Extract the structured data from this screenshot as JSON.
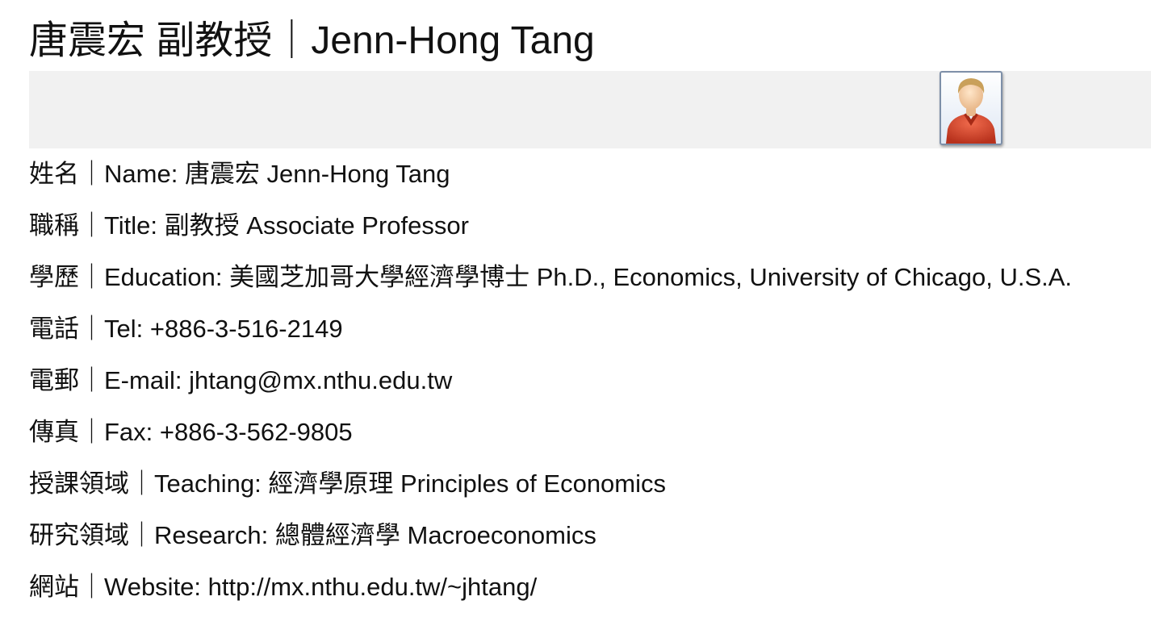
{
  "header": {
    "title": "唐震宏 副教授｜Jenn-Hong Tang"
  },
  "photo": {
    "icon": "user-avatar-icon"
  },
  "rows": [
    {
      "label": "姓名｜Name:",
      "value": "唐震宏 Jenn-Hong Tang"
    },
    {
      "label": "職稱｜Title:",
      "value": "副教授 Associate Professor"
    },
    {
      "label": "學歷｜Education:",
      "value": "美國芝加哥大學經濟學博士 Ph.D., Economics, University of Chicago, U.S.A."
    },
    {
      "label": "電話｜Tel:",
      "value": "+886-3-516-2149"
    },
    {
      "label": "電郵｜E-mail:",
      "value": "jhtang@mx.nthu.edu.tw"
    },
    {
      "label": "傳真｜Fax:",
      "value": "+886-3-562-9805"
    },
    {
      "label": "授課領域｜Teaching:",
      "value": "經濟學原理 Principles of Economics"
    },
    {
      "label": "研究領域｜Research:",
      "value": "總體經濟學 Macroeconomics"
    },
    {
      "label": "網站｜Website:",
      "value": "http://mx.nthu.edu.tw/~jhtang/"
    }
  ],
  "colors": {
    "band": "#f1f1f1",
    "text": "#111111",
    "avatar_shirt": "#d5452a"
  }
}
